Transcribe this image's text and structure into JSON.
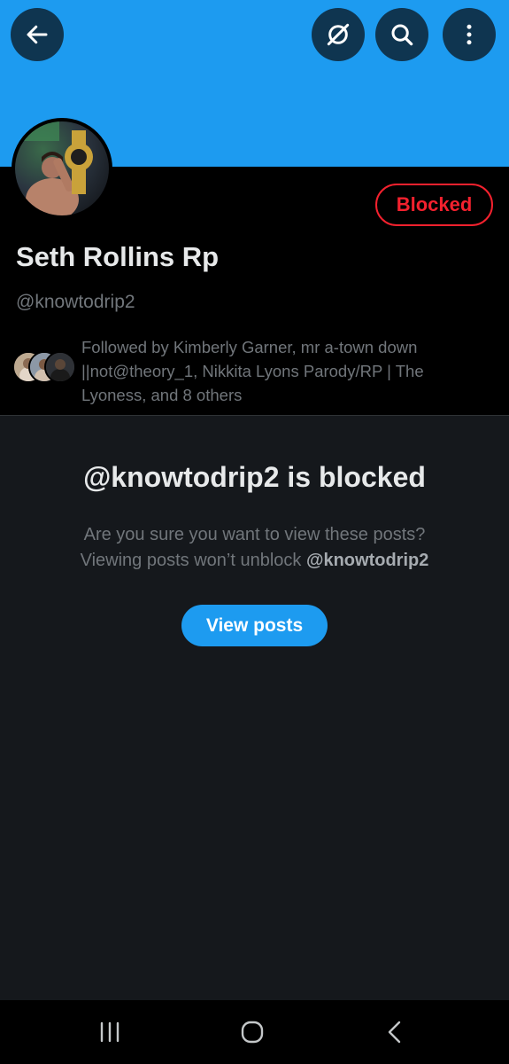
{
  "header": {
    "back_icon": "arrow-left-icon",
    "hide_icon": "circle-slash-icon",
    "search_icon": "search-icon",
    "more_icon": "more-vertical-icon",
    "banner_color": "#1d9bf0"
  },
  "profile": {
    "display_name": "Seth Rollins Rp",
    "handle": "@knowtodrip2",
    "blocked_label": "Blocked",
    "followed_by_text": "Followed by Kimberly Garner, mr a-town down ||not@theory_1, Nikkita Lyons Parody/RP | The Lyoness, and 8 others"
  },
  "blocked_notice": {
    "title": "@knowtodrip2 is blocked",
    "message_line1": "Are you sure you want to view these posts?",
    "message_line2_prefix": "Viewing posts won’t unblock ",
    "message_line2_handle": "@knowtodrip2",
    "view_button_label": "View posts"
  },
  "system_nav": {
    "recents_icon": "recents-icon",
    "home_icon": "home-icon",
    "back_icon": "back-chevron-icon"
  },
  "colors": {
    "accent": "#1d9bf0",
    "blocked_red": "#f4212e",
    "secondary_text": "#71767b"
  }
}
